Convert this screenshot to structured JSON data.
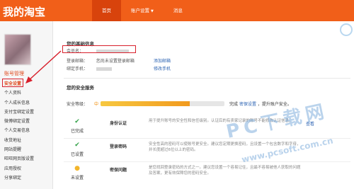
{
  "header": {
    "brand": "我的淘宝",
    "tabs": [
      {
        "label": "首页"
      },
      {
        "label": "账户设置"
      },
      {
        "label": "消息"
      }
    ]
  },
  "sidebar": {
    "section_title": "账号管理",
    "items": [
      {
        "label": "安全设置"
      },
      {
        "label": "个人资料"
      },
      {
        "label": "个人成长信息"
      },
      {
        "label": "支付宝绑定设置"
      },
      {
        "label": "微博绑定设置"
      },
      {
        "label": "个人交易信息"
      },
      {
        "label": "收货地址"
      },
      {
        "label": "网站提醒"
      },
      {
        "label": "旺旺网页版设置"
      },
      {
        "label": "应用授权"
      },
      {
        "label": "分享绑定"
      }
    ]
  },
  "basic_info": {
    "title": "您的基础信息",
    "member_label": "会员名：",
    "email_label": "登录邮箱：",
    "email_value": "您尚未设置登录邮箱",
    "email_action": "添加邮箱",
    "phone_label": "绑定手机：",
    "phone_action": "修改手机"
  },
  "security": {
    "title": "您的安全服务",
    "level_label": "安全等级：",
    "level_value": "中",
    "level_percent": 0.72,
    "level_tip_prefix": "完成",
    "level_tip_link": "密保设置",
    "level_tip_suffix": "，提升账户安全。",
    "services": [
      {
        "icon": "check-icon",
        "status": "已完成",
        "name": "身份认证",
        "desc": "用于提升账号的安全性和信任级别。认证后的有卖家记录的账号不能修改认证信息。",
        "action": "查看"
      },
      {
        "icon": "check-icon",
        "status": "已设置",
        "name": "登录密码",
        "desc": "安全性高的密码可以使账号更安全。建议您定期更换密码，且设置一个包含数字和字母，并长度超过6位以上的密码。",
        "action": ""
      },
      {
        "icon": "warning-icon",
        "status": "未设置",
        "name": "密保问题",
        "desc": "是您找回登录密码的方式之一。建议您设置一个容易记住，且最不容易被他人获取的问题及答案，更有效保障您的密码安全。",
        "action": ""
      }
    ]
  },
  "watermark": {
    "brand": "PC下载网",
    "url": "www.pcsoft.com.cn"
  },
  "colors": {
    "header": "#f15f19",
    "header_active": "#d8430c",
    "highlight_box": "#d8202c",
    "link": "#2d64b3"
  }
}
